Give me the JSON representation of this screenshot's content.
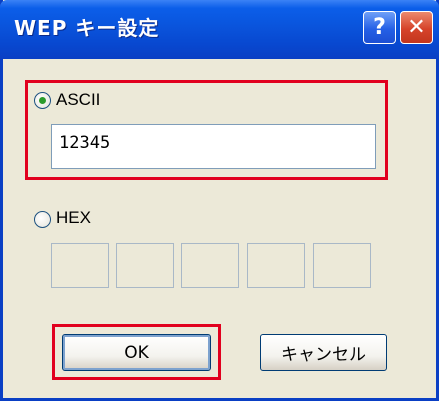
{
  "dialog": {
    "title": "WEP キー設定",
    "help_label": "?",
    "close_label": "✕"
  },
  "ascii": {
    "label": "ASCII",
    "selected": true,
    "value": "12345"
  },
  "hex": {
    "label": "HEX",
    "selected": false,
    "fields": [
      "",
      "",
      "",
      "",
      ""
    ]
  },
  "buttons": {
    "ok_label": "OK",
    "cancel_label": "キャンセル"
  },
  "colors": {
    "titlebar": "#0a54dc",
    "highlight": "#e1001e",
    "dialog_bg": "#ece9d8",
    "radio_dot": "#2b9b2b"
  }
}
